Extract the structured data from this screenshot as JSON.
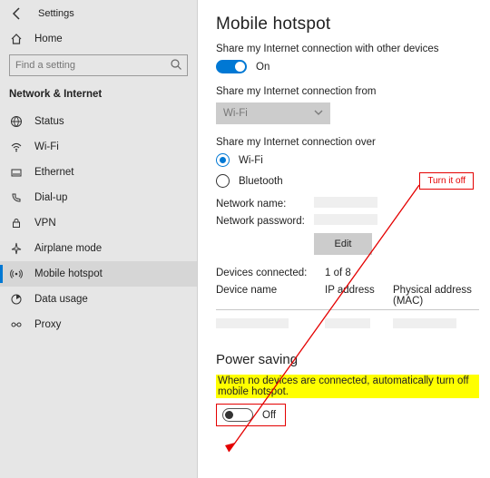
{
  "header": {
    "app": "Settings",
    "home": "Home"
  },
  "search": {
    "placeholder": "Find a setting"
  },
  "section": "Network & Internet",
  "sidebar": {
    "items": [
      {
        "label": "Status"
      },
      {
        "label": "Wi-Fi"
      },
      {
        "label": "Ethernet"
      },
      {
        "label": "Dial-up"
      },
      {
        "label": "VPN"
      },
      {
        "label": "Airplane mode"
      },
      {
        "label": "Mobile hotspot"
      },
      {
        "label": "Data usage"
      },
      {
        "label": "Proxy"
      }
    ]
  },
  "page": {
    "title": "Mobile hotspot",
    "share_label": "Share my Internet connection with other devices",
    "share_toggle_state": "On",
    "from_label": "Share my Internet connection from",
    "from_value": "Wi-Fi",
    "over_label": "Share my Internet connection over",
    "radio": {
      "wifi": "Wi-Fi",
      "bluetooth": "Bluetooth"
    },
    "net_name_label": "Network name:",
    "net_pass_label": "Network password:",
    "edit_btn": "Edit",
    "devices_connected_label": "Devices connected:",
    "devices_connected_value": "1 of 8",
    "table": {
      "c1": "Device name",
      "c2": "IP address",
      "c3": "Physical address (MAC)"
    },
    "ps_heading": "Power saving",
    "ps_text": "When no devices are connected, automatically turn off mobile hotspot.",
    "ps_toggle_state": "Off"
  },
  "annotation": {
    "callout": "Turn it off"
  }
}
